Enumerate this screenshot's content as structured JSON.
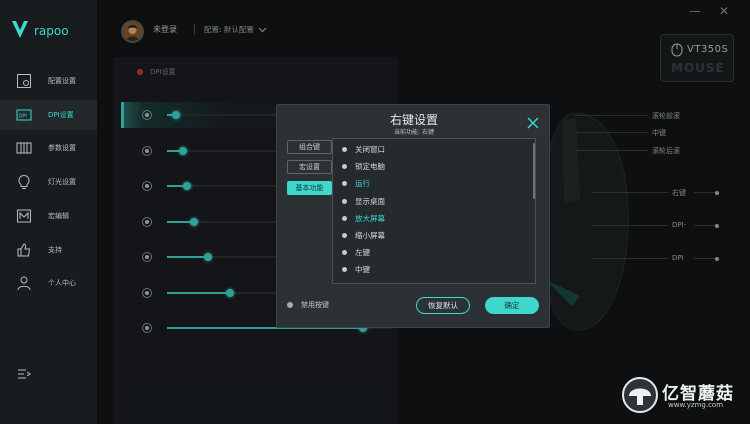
{
  "app": {
    "brand": "rapoo"
  },
  "colors": {
    "accent": "#3ed8cc",
    "status_dot": "#d03434"
  },
  "sidebar": {
    "items": [
      {
        "label": "配置设置",
        "icon": "config-icon"
      },
      {
        "label": "DPI设置",
        "icon": "dpi-icon",
        "active": true
      },
      {
        "label": "参数设置",
        "icon": "params-icon"
      },
      {
        "label": "灯光设置",
        "icon": "light-bulb-icon"
      },
      {
        "label": "宏编辑",
        "icon": "macro-icon"
      },
      {
        "label": "支持",
        "icon": "thumbs-up-icon"
      },
      {
        "label": "个人中心",
        "icon": "user-icon"
      }
    ],
    "menu_icon": "collapse-menu-icon"
  },
  "topbar": {
    "login": "未登录",
    "config": "配置: 默认配置",
    "minimize": "—",
    "close": "✕"
  },
  "device": {
    "model": "VT350S",
    "kind": "MOUSE"
  },
  "dpi": {
    "header": "DPI设置",
    "levels": [
      0.04,
      0.07,
      0.09,
      0.12,
      0.18,
      0.28,
      0.87
    ],
    "active_index": 0
  },
  "mouse_labels": [
    "滚轮前滚",
    "中键",
    "滚轮后滚",
    "右键",
    "DPI-",
    "DPI"
  ],
  "dialog": {
    "title": "右键设置",
    "subtitle": "当前功能: 右键",
    "tabs": [
      "组合键",
      "宏设置",
      "基本功能"
    ],
    "active_tab": 2,
    "options": [
      "关闭窗口",
      "锁定电脑",
      "运行",
      "显示桌面",
      "放大屏幕",
      "缩小屏幕",
      "左键",
      "中键",
      "右键"
    ],
    "highlighted": [
      2,
      4
    ],
    "disable_label": "禁用按键",
    "reset_label": "恢复默认",
    "ok_label": "确定"
  },
  "watermark": {
    "name": "亿智蘑菇",
    "url": "www.yzmg.com"
  }
}
